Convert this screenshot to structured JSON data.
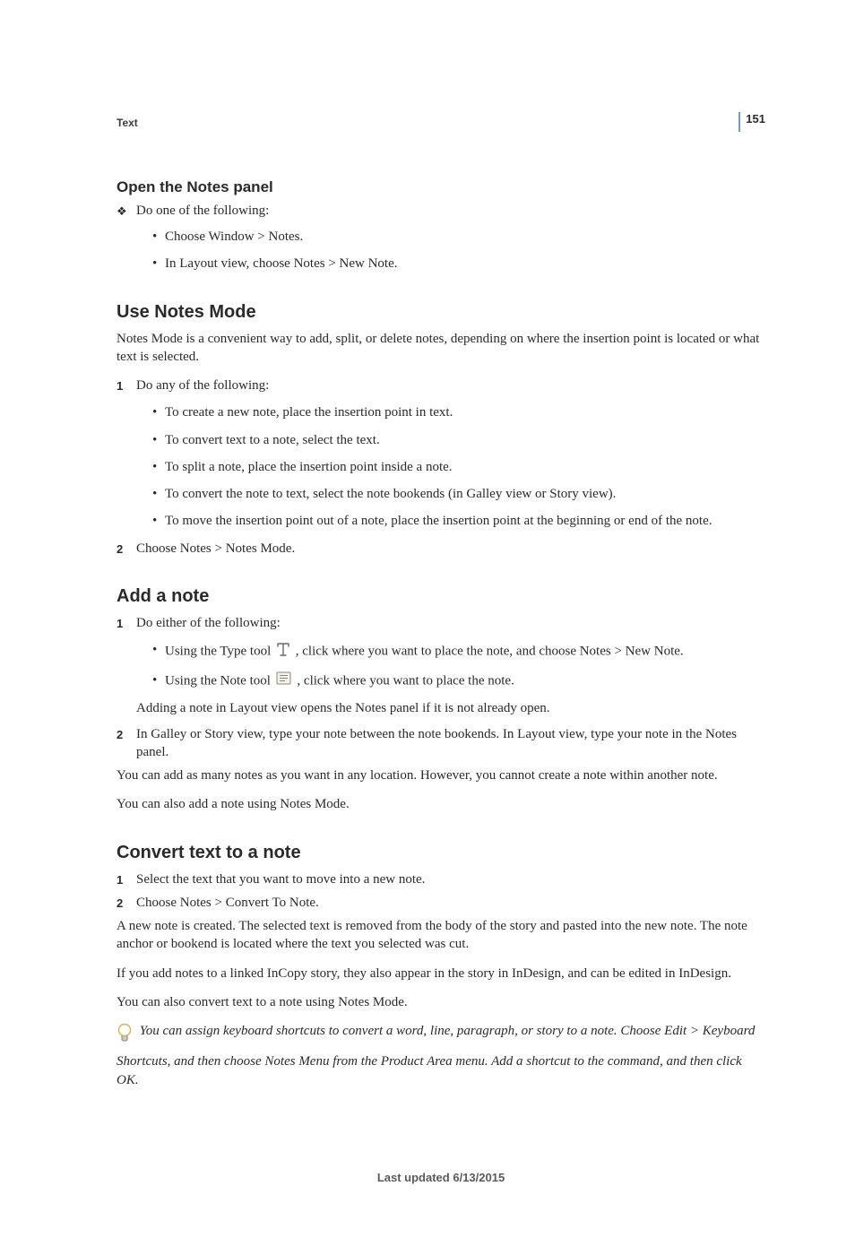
{
  "page_number": "151",
  "running_head": "Text",
  "sections": {
    "open_notes": {
      "heading": "Open the Notes panel",
      "lead": "Do one of the following:",
      "bullets": [
        "Choose Window > Notes.",
        "In Layout view, choose Notes > New Note."
      ]
    },
    "use_notes_mode": {
      "heading": "Use Notes Mode",
      "intro": "Notes Mode is a convenient way to add, split, or delete notes, depending on where the insertion point is located or what text is selected.",
      "step1": "Do any of the following:",
      "bullets": [
        "To create a new note, place the insertion point in text.",
        "To convert text to a note, select the text.",
        "To split a note, place the insertion point inside a note.",
        "To convert the note to text, select the note bookends (in Galley view or Story view).",
        "To move the insertion point out of a note, place the insertion point at the beginning or end of the note."
      ],
      "step2": "Choose Notes > Notes Mode."
    },
    "add_note": {
      "heading": "Add a note",
      "step1": "Do either of the following:",
      "b1_pre": "Using the Type tool ",
      "b1_post": " , click where you want to place the note, and choose Notes > New Note.",
      "b2_pre": "Using the Note tool ",
      "b2_post": " , click where you want to place the note.",
      "after1": "Adding a note in Layout view opens the Notes panel if it is not already open.",
      "step2": "In Galley or Story view, type your note between the note bookends. In Layout view, type your note in the Notes panel.",
      "p1": "You can add as many notes as you want in any location. However, you cannot create a note within another note.",
      "p2": "You can also add a note using Notes Mode."
    },
    "convert": {
      "heading": "Convert text to a note",
      "step1": "Select the text that you want to move into a new note.",
      "step2": "Choose Notes > Convert To Note.",
      "p1": "A new note is created. The selected text is removed from the body of the story and pasted into the new note. The note anchor or bookend is located where the text you selected was cut.",
      "p2": "If you add notes to a linked InCopy story, they also appear in the story in InDesign, and can be edited in InDesign.",
      "p3": "You can also convert text to a note using Notes Mode.",
      "tip": "You can assign keyboard shortcuts to convert a word, line, paragraph, or story to a note. Choose Edit > Keyboard Shortcuts, and then choose Notes Menu from the Product Area menu. Add a shortcut to the command, and then click OK."
    }
  },
  "footer": "Last updated 6/13/2015"
}
